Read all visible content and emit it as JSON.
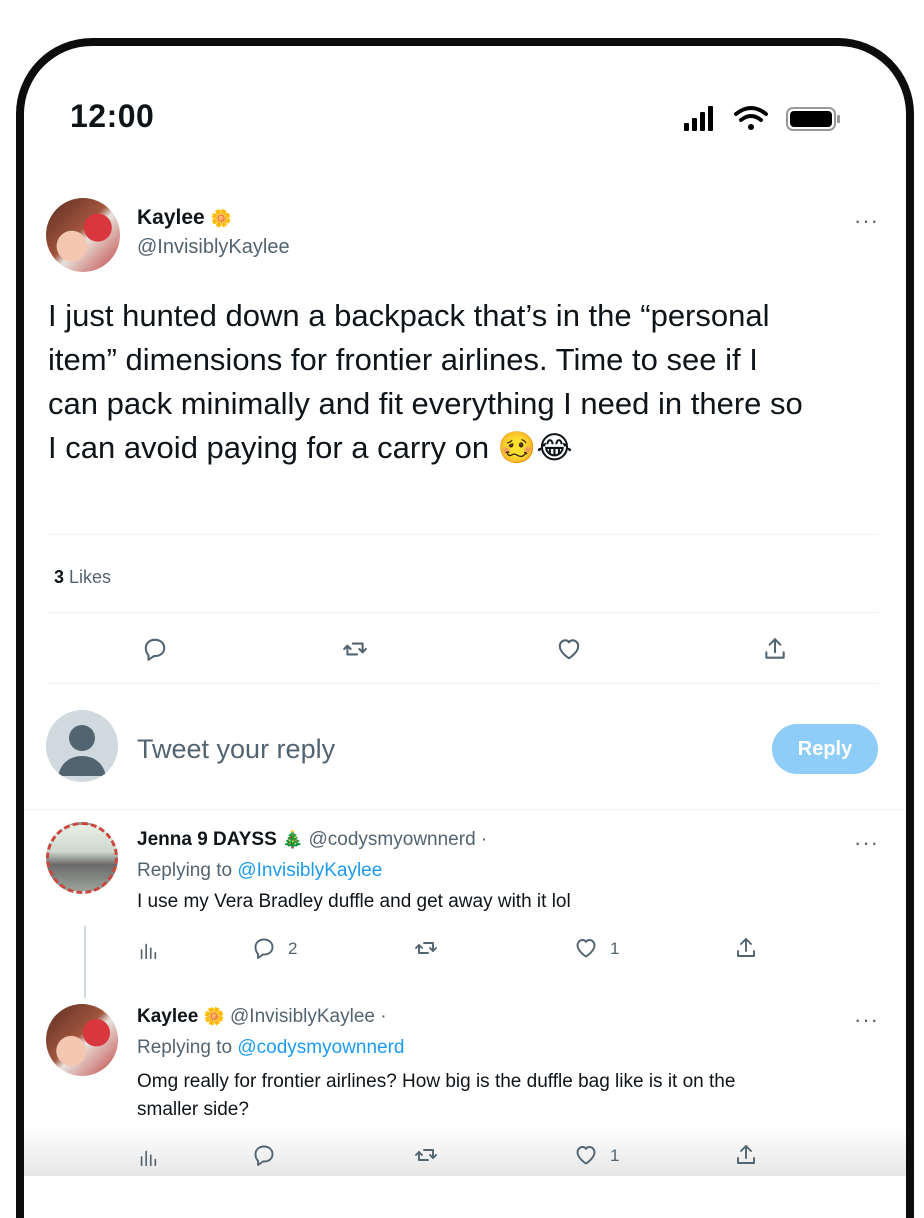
{
  "status_bar": {
    "time": "12:00"
  },
  "tweet": {
    "author_name": "Kaylee",
    "author_emoji": "🌼",
    "author_handle": "@InvisiblyKaylee",
    "more": "···",
    "text_line1": "I just hunted down a backpack that’s in the “personal",
    "text_line2": "item” dimensions for frontier airlines. Time to see if I",
    "text_line3": "can pack minimally and fit everything I need in there so",
    "text_line4": "I can avoid paying for a carry on 🥴😂",
    "likes_count": "3",
    "likes_label": "Likes"
  },
  "compose": {
    "placeholder": "Tweet your reply",
    "reply_button": "Reply"
  },
  "replies": [
    {
      "author_name": "Jenna 9 DAYSS",
      "author_emoji": "🎄",
      "author_handle": "@codysmyownnerd",
      "dot": "·",
      "replying_prefix": "Replying to",
      "replying_to": "@InvisiblyKaylee",
      "text": "I use my Vera Bradley duffle and get away with it lol",
      "more": "···",
      "reply_count": "2",
      "like_count": "1"
    },
    {
      "author_name": "Kaylee",
      "author_emoji": "🌼",
      "author_handle": "@InvisiblyKaylee",
      "dot": "·",
      "replying_prefix": "Replying to",
      "replying_to": "@codysmyownnerd",
      "text_line1": "Omg really for frontier airlines? How big is the duffle bag like is it on the",
      "text_line2": "smaller side?",
      "more": "···",
      "like_count": "1"
    }
  ],
  "icons": [
    "signal-icon",
    "wifi-icon",
    "battery-icon",
    "reply-icon",
    "retweet-icon",
    "like-icon",
    "share-icon",
    "analytics-icon",
    "more-icon"
  ]
}
